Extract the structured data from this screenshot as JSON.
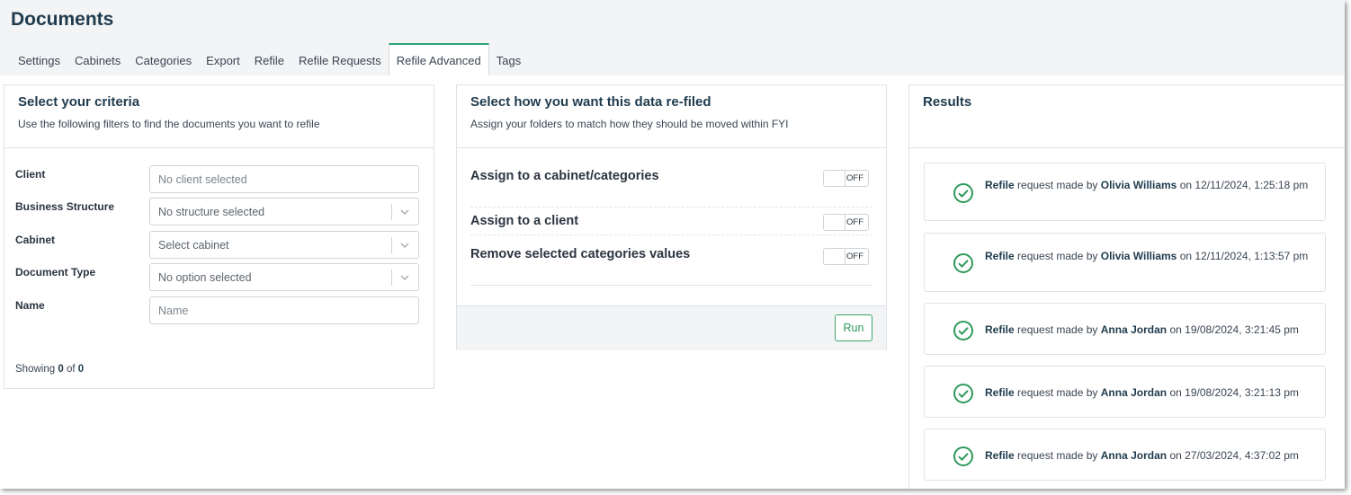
{
  "app": {
    "title": "Documents"
  },
  "tabs": [
    {
      "label": "Settings",
      "active": false
    },
    {
      "label": "Cabinets",
      "active": false
    },
    {
      "label": "Categories",
      "active": false
    },
    {
      "label": "Export",
      "active": false
    },
    {
      "label": "Refile",
      "active": false
    },
    {
      "label": "Refile Requests",
      "active": false
    },
    {
      "label": "Refile Advanced",
      "active": true
    },
    {
      "label": "Tags",
      "active": false
    }
  ],
  "criteria": {
    "title": "Select your criteria",
    "subtitle": "Use the following filters to find the documents you want to refile",
    "client": {
      "label": "Client",
      "placeholder": "No client selected"
    },
    "business_structure": {
      "label": "Business Structure",
      "selected": "No structure selected"
    },
    "cabinet": {
      "label": "Cabinet",
      "selected": "Select cabinet"
    },
    "document_type": {
      "label": "Document Type",
      "selected": "No option selected"
    },
    "name": {
      "label": "Name",
      "placeholder": "Name"
    },
    "showing": {
      "prefix": "Showing",
      "from": "0",
      "of_word": "of",
      "total": "0"
    }
  },
  "refile": {
    "title": "Select how you want this data re-filed",
    "subtitle": "Assign your folders to match how they should be moved within FYI",
    "options": [
      {
        "label": "Assign to a cabinet/categories",
        "state": "OFF"
      },
      {
        "label": "Assign to a client",
        "state": "OFF"
      },
      {
        "label": "Remove selected categories values",
        "state": "OFF"
      }
    ],
    "run_label": "Run"
  },
  "results": {
    "title": "Results",
    "items": [
      {
        "action": "Refile",
        "middle": "request made by",
        "user": "Olivia Williams",
        "on_word": "on",
        "timestamp": "12/11/2024, 1:25:18 pm",
        "status": "success"
      },
      {
        "action": "Refile",
        "middle": "request made by",
        "user": "Olivia Williams",
        "on_word": "on",
        "timestamp": "12/11/2024, 1:13:57 pm",
        "status": "success"
      },
      {
        "action": "Refile",
        "middle": "request made by",
        "user": "Anna Jordan",
        "on_word": "on",
        "timestamp": "19/08/2024, 3:21:45 pm",
        "status": "success"
      },
      {
        "action": "Refile",
        "middle": "request made by",
        "user": "Anna Jordan",
        "on_word": "on",
        "timestamp": "19/08/2024, 3:21:13 pm",
        "status": "success"
      },
      {
        "action": "Refile",
        "middle": "request made by",
        "user": "Anna Jordan",
        "on_word": "on",
        "timestamp": "27/03/2024, 4:37:02 pm",
        "status": "success"
      }
    ]
  },
  "colors": {
    "accent_tab": "#2aa47a",
    "success": "#2e9a5c",
    "title": "#1f3b4d"
  }
}
